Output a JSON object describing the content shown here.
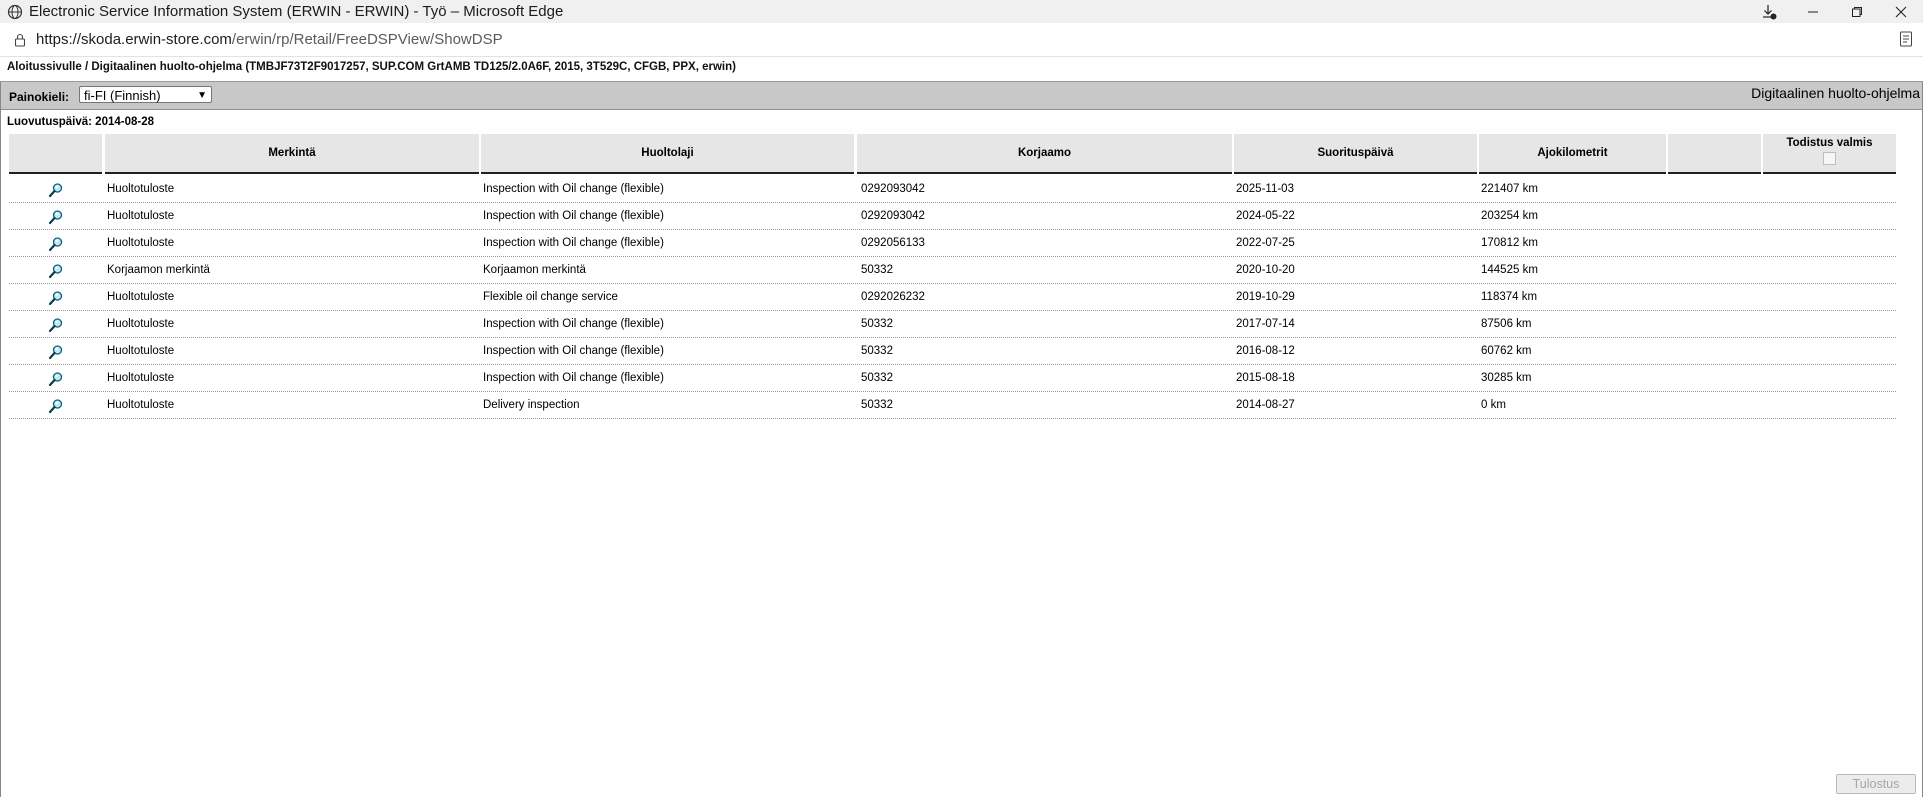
{
  "browser": {
    "title": "Electronic Service Information System (ERWIN - ERWIN) - Työ – Microsoft Edge",
    "url_host": "https://skoda.erwin-store.com",
    "url_path": "/erwin/rp/Retail/FreeDSPView/ShowDSP"
  },
  "page": {
    "breadcrumb": "Aloitussivulle / Digitaalinen huolto-ohjelma (TMBJF73T2F9017257, SUP.COM GrtAMB TD125/2.0A6F, 2015, 3T529C, CFGB, PPX, erwin)",
    "language_label": "Painokieli:",
    "language_value": "fi-FI (Finnish)",
    "page_title": "Digitaalinen huolto-ohjelma",
    "delivery_date": "Luovutuspäivä: 2014-08-28",
    "print_button": "Tulostus"
  },
  "table": {
    "headers": {
      "view": "",
      "merkinta": "Merkintä",
      "huoltolaji": "Huoltolaji",
      "korjaamo": "Korjaamo",
      "suorituspaiva": "Suorituspäivä",
      "ajokilometrit": "Ajokilometrit",
      "blank": "",
      "todistus": "Todistus valmis"
    },
    "rows": [
      {
        "merkinta": "Huoltotuloste",
        "huoltolaji": "Inspection with Oil change (flexible)",
        "korjaamo": "0292093042",
        "paiva": "2025-11-03",
        "km": "221407 km"
      },
      {
        "merkinta": "Huoltotuloste",
        "huoltolaji": "Inspection with Oil change (flexible)",
        "korjaamo": "0292093042",
        "paiva": "2024-05-22",
        "km": "203254 km"
      },
      {
        "merkinta": "Huoltotuloste",
        "huoltolaji": "Inspection with Oil change (flexible)",
        "korjaamo": "0292056133",
        "paiva": "2022-07-25",
        "km": "170812 km"
      },
      {
        "merkinta": "Korjaamon merkintä",
        "huoltolaji": "Korjaamon merkintä",
        "korjaamo": "50332",
        "paiva": "2020-10-20",
        "km": "144525 km"
      },
      {
        "merkinta": "Huoltotuloste",
        "huoltolaji": "Flexible oil change service",
        "korjaamo": "0292026232",
        "paiva": "2019-10-29",
        "km": "118374 km"
      },
      {
        "merkinta": "Huoltotuloste",
        "huoltolaji": "Inspection with Oil change (flexible)",
        "korjaamo": "50332",
        "paiva": "2017-07-14",
        "km": "87506 km"
      },
      {
        "merkinta": "Huoltotuloste",
        "huoltolaji": "Inspection with Oil change (flexible)",
        "korjaamo": "50332",
        "paiva": "2016-08-12",
        "km": "60762 km"
      },
      {
        "merkinta": "Huoltotuloste",
        "huoltolaji": "Inspection with Oil change (flexible)",
        "korjaamo": "50332",
        "paiva": "2015-08-18",
        "km": "30285 km"
      },
      {
        "merkinta": "Huoltotuloste",
        "huoltolaji": "Delivery inspection",
        "korjaamo": "50332",
        "paiva": "2014-08-27",
        "km": "0 km"
      }
    ]
  }
}
